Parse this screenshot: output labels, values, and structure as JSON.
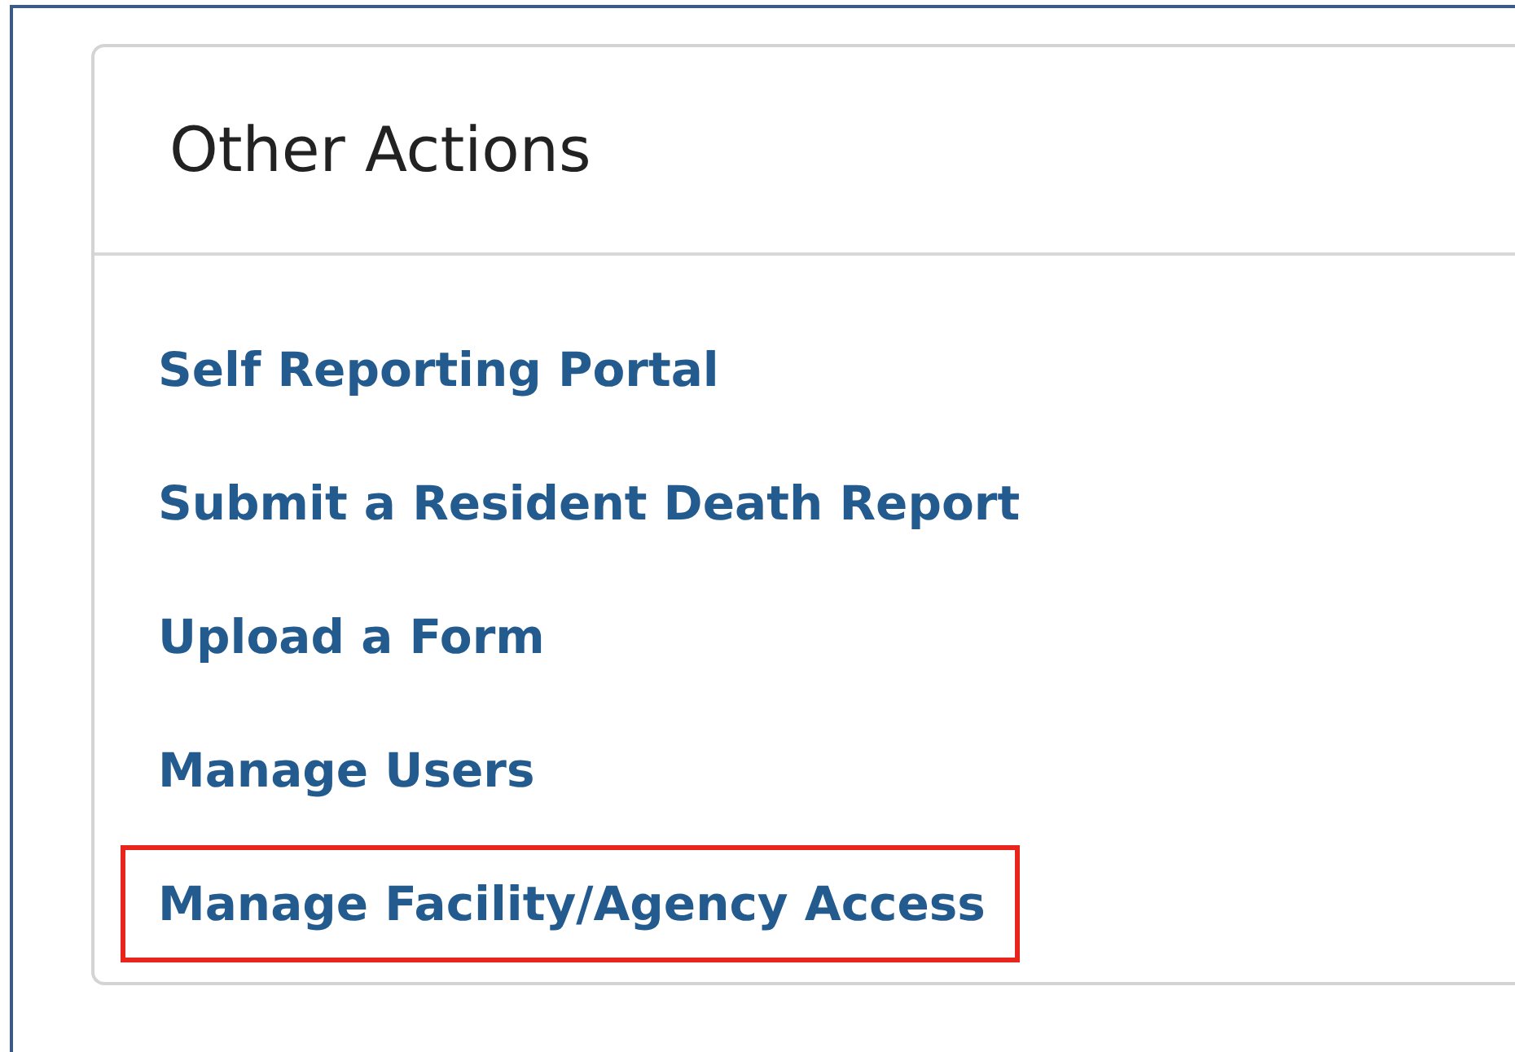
{
  "card": {
    "title": "Other Actions",
    "links": [
      {
        "label": "Self Reporting Portal",
        "highlighted": false
      },
      {
        "label": "Submit a Resident Death Report",
        "highlighted": false
      },
      {
        "label": "Upload a Form",
        "highlighted": false
      },
      {
        "label": "Manage Users",
        "highlighted": false
      },
      {
        "label": "Manage Facility/Agency Access",
        "highlighted": true
      }
    ]
  }
}
